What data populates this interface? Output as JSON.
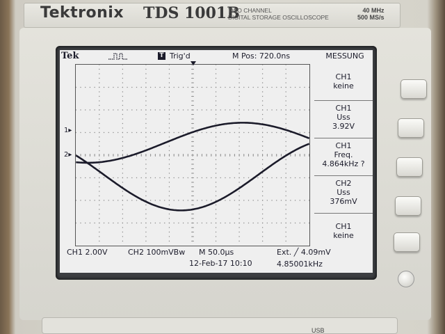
{
  "device": {
    "brand": "Tektronix",
    "model": "TDS 1001B",
    "subtitle_line1": "TWO CHANNEL",
    "subtitle_line2": "DIGITAL STORAGE OSCILLOSCOPE",
    "spec_bandwidth": "40 MHz",
    "spec_samplerate": "500 MS/s",
    "usb_label": "USB"
  },
  "screen": {
    "logo": "Tek",
    "trigger_icon": "T",
    "trigger_status": "Trig'd",
    "mpos": "M Pos: 720.0ns",
    "menu_title": "MESSUNG",
    "ch1_marker": "1",
    "ch2_marker": "2",
    "measurements": [
      {
        "line1": "CH1",
        "line2": "keine",
        "line3": ""
      },
      {
        "line1": "CH1",
        "line2": "Uss",
        "line3": "3.92V"
      },
      {
        "line1": "CH1",
        "line2": "Freq.",
        "line3": "4.864kHz ?"
      },
      {
        "line1": "CH2",
        "line2": "Uss",
        "line3": "376mV"
      },
      {
        "line1": "CH1",
        "line2": "keine",
        "line3": ""
      }
    ],
    "bottom": {
      "ch1_scale": "CH1  2.00V",
      "ch2_scale": "CH2   100mVBw",
      "timebase": "M 50.0µs",
      "trigger": "Ext. ╱ 4.09mV",
      "date": "12-Feb-17 10:10",
      "freq": "4.85001kHz"
    }
  },
  "colors": {
    "screen_bg": "#efefef",
    "trace": "#1b1b2a",
    "grid": "#8a8a8a"
  }
}
